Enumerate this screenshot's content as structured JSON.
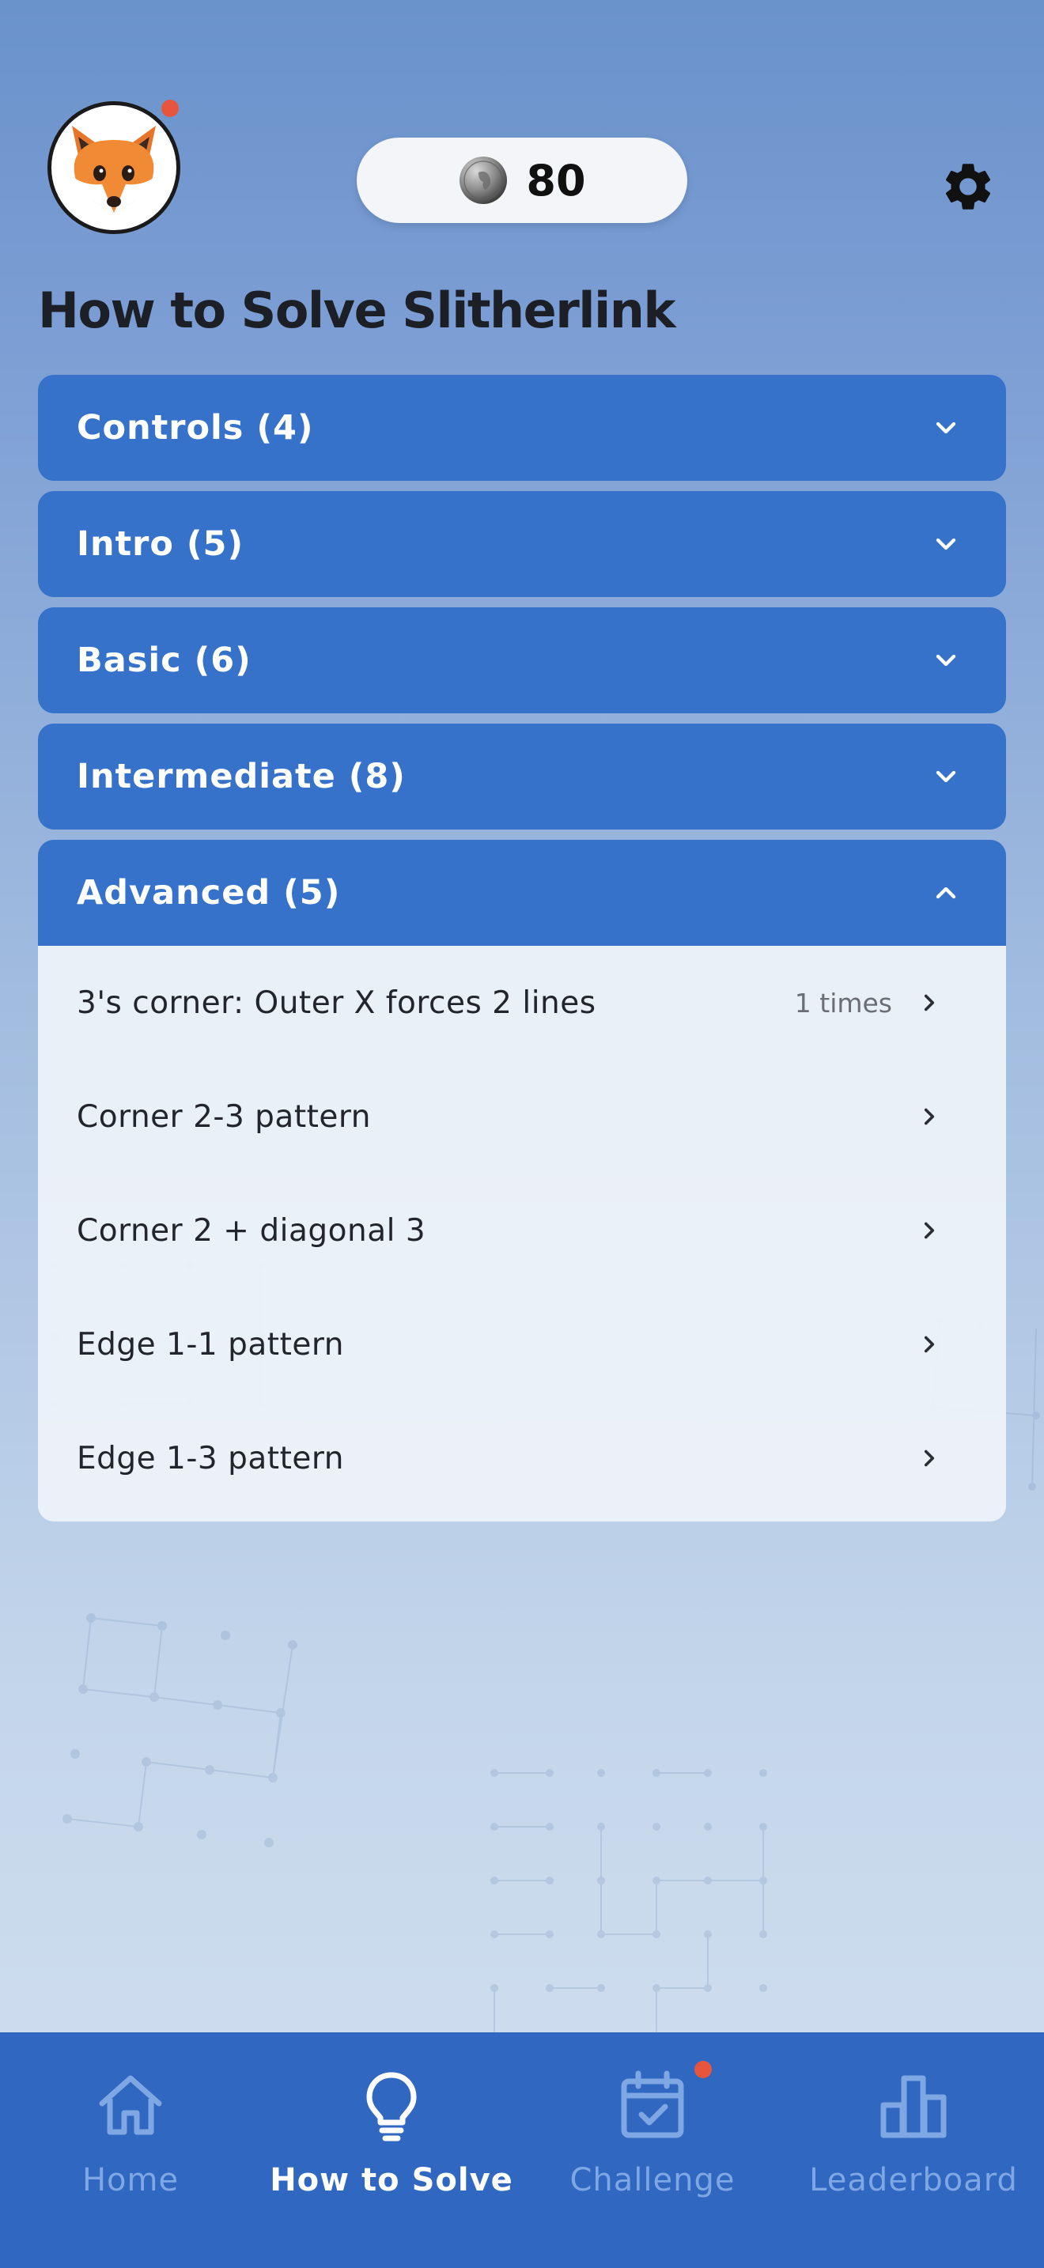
{
  "header": {
    "avatar_icon": "fox-icon",
    "coins": "80",
    "coin_icon": "coin-icon",
    "settings_icon": "gear-icon"
  },
  "page_title": "How to Solve Slitherlink",
  "sections": [
    {
      "label": "Controls (4)",
      "expanded": false
    },
    {
      "label": "Intro (5)",
      "expanded": false
    },
    {
      "label": "Basic (6)",
      "expanded": false
    },
    {
      "label": "Intermediate (8)",
      "expanded": false
    },
    {
      "label": "Advanced (5)",
      "expanded": true,
      "items": [
        {
          "label": "3's corner: Outer X forces 2 lines",
          "count": "1 times"
        },
        {
          "label": "Corner 2-3 pattern",
          "count": ""
        },
        {
          "label": "Corner 2 + diagonal 3",
          "count": ""
        },
        {
          "label": "Edge 1-1 pattern",
          "count": ""
        },
        {
          "label": "Edge 1-3 pattern",
          "count": ""
        }
      ]
    }
  ],
  "nav": [
    {
      "label": "Home",
      "icon": "home-icon",
      "active": false
    },
    {
      "label": "How to Solve",
      "icon": "lightbulb-icon",
      "active": true
    },
    {
      "label": "Challenge",
      "icon": "calendar-check-icon",
      "active": false,
      "badge": true
    },
    {
      "label": "Leaderboard",
      "icon": "bar-chart-icon",
      "active": false
    }
  ],
  "colors": {
    "accent": "#3672c9",
    "nav_bg": "#3067c0",
    "badge": "#e8553f",
    "nav_inactive": "#7fa7e3"
  }
}
